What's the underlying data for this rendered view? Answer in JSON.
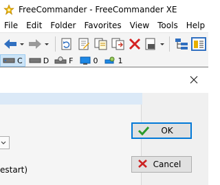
{
  "window": {
    "title": "FreeCommander - FreeCommander XE"
  },
  "menu": {
    "items": [
      "File",
      "Edit",
      "Folder",
      "Favorites",
      "View",
      "Tools",
      "Help"
    ]
  },
  "drives": [
    {
      "letter": "C",
      "active": true
    },
    {
      "letter": "D",
      "active": false
    },
    {
      "letter": "F",
      "active": false
    },
    {
      "letter": "0",
      "active": false
    },
    {
      "letter": "1",
      "active": false
    }
  ],
  "dialog": {
    "restart_text": "estart)",
    "ok_label": "OK",
    "cancel_label": "Cancel"
  },
  "colors": {
    "accent": "#0078d7",
    "ok_green": "#2a9a2a",
    "cancel_red": "#cc2222"
  }
}
